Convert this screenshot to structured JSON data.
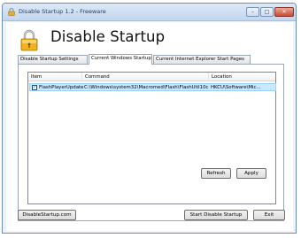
{
  "window": {
    "title": "Disable Startup 1.2 - Freeware",
    "controls": {
      "minimize": "–",
      "maximize": "□",
      "close": "✕"
    }
  },
  "header": {
    "icon": "padlock-icon",
    "title": "Disable Startup"
  },
  "tabs": [
    {
      "label": "Disable Startup Settings",
      "active": false
    },
    {
      "label": "Current Windows Startup",
      "active": true
    },
    {
      "label": "Current Internet Explorer Start Pages",
      "active": false
    }
  ],
  "list": {
    "columns": [
      "Item",
      "Command",
      "Location"
    ],
    "rows": [
      {
        "checked": true,
        "check_glyph": "✓",
        "item": "FlashPlayerUpdate",
        "command": "C:\\Windows\\system32\\Macromed\\Flash\\FlashUtil10c...",
        "location": "HKCU\\Software\\Mic..."
      }
    ]
  },
  "buttons": {
    "refresh": "Refresh",
    "apply": "Apply",
    "website": "DisableStartup.com",
    "start_disable": "Start Disable Startup",
    "exit": "Exit"
  },
  "colors": {
    "selection": "#cce8ff",
    "title_bar": "#c3d6ee",
    "close_button": "#c74a33"
  }
}
